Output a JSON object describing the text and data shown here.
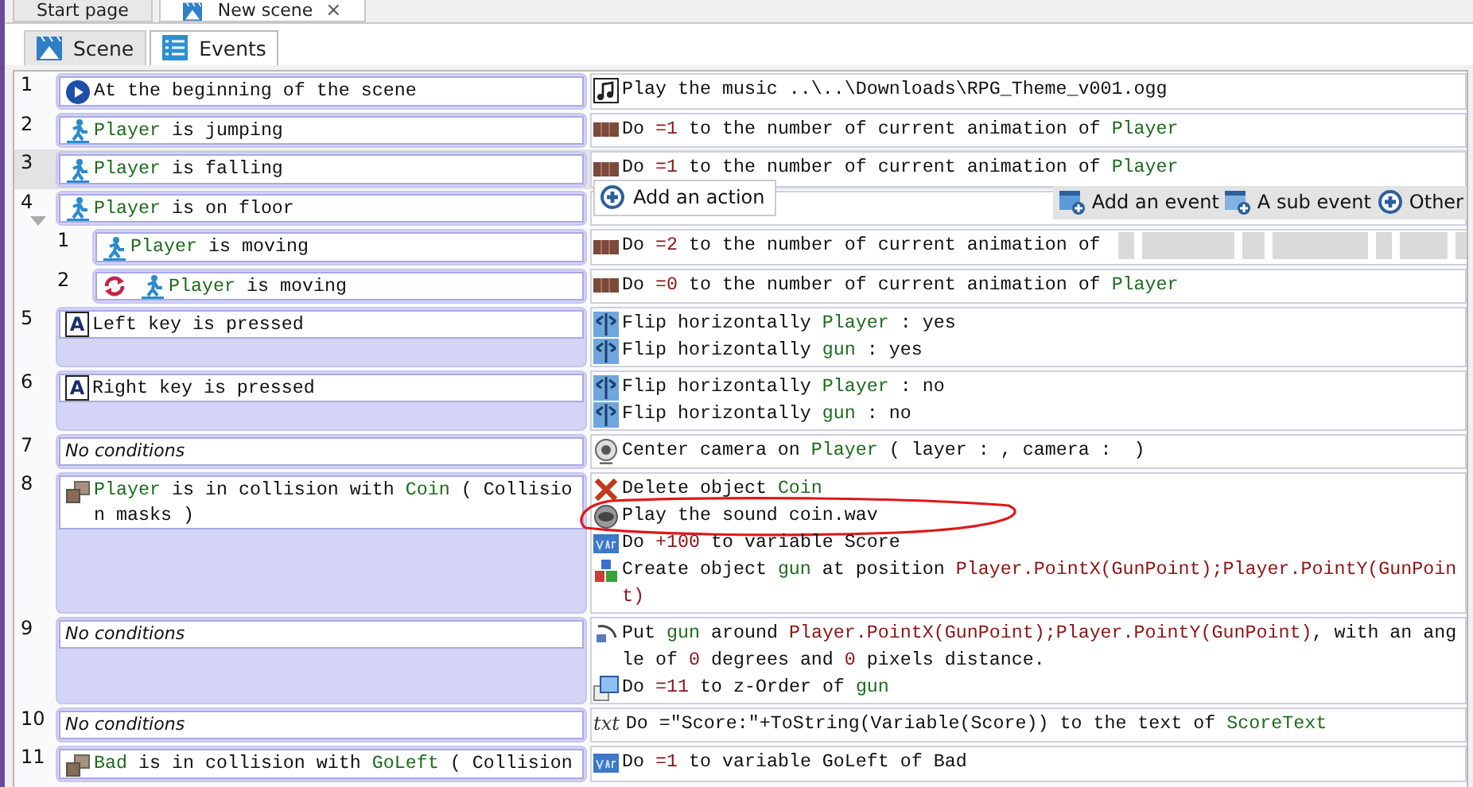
{
  "document_tabs": [
    {
      "label": "Start page",
      "selected": false
    },
    {
      "label": "New scene",
      "selected": true,
      "close": "×"
    }
  ],
  "editor_tabs": [
    {
      "label": "Scene",
      "kind": "scene",
      "selected": false
    },
    {
      "label": "Events",
      "kind": "events",
      "selected": true
    }
  ],
  "events": [
    {
      "number": "1",
      "selected": false,
      "expanded": false,
      "conditions": [
        {
          "kind": "start",
          "parts": [
            "At the beginning of the scene"
          ]
        }
      ],
      "actions": [
        {
          "kind": "music",
          "parts": [
            "Play the music ..\\..\\Downloads\\RPG_Theme_v001.ogg"
          ]
        }
      ]
    },
    {
      "number": "2",
      "selected": false,
      "expanded": false,
      "conditions": [
        {
          "kind": "object",
          "parts": [
            {
              "text": "Player",
              "kind": "object"
            },
            " is jumping"
          ]
        }
      ],
      "actions": [
        {
          "kind": "animation",
          "parts": [
            "Do ",
            {
              "text": "=1",
              "kind": "expr"
            },
            " to the number of current animation of ",
            {
              "text": "Player",
              "kind": "object"
            }
          ]
        }
      ]
    },
    {
      "number": "3",
      "selected": true,
      "expanded": false,
      "conditions": [
        {
          "kind": "object",
          "parts": [
            {
              "text": "Player",
              "kind": "object"
            },
            " is falling"
          ]
        }
      ],
      "actions": [
        {
          "kind": "animation",
          "parts": [
            "Do ",
            {
              "text": "=1",
              "kind": "expr"
            },
            " to the number of current animation of ",
            {
              "text": "Player",
              "kind": "object"
            }
          ]
        }
      ]
    },
    {
      "number": "4",
      "selected": false,
      "expanded": true,
      "conditions": [
        {
          "kind": "object",
          "parts": [
            {
              "text": "Player",
              "kind": "object"
            },
            " is on floor"
          ]
        }
      ],
      "popup": {
        "label": "Add an action"
      },
      "toolbar": [
        {
          "label": "Add an event",
          "kind": "event"
        },
        {
          "label": "A sub event",
          "kind": "sub-event"
        },
        {
          "label": "Other",
          "kind": "other"
        }
      ],
      "children": [
        {
          "number": "1",
          "selected": false,
          "expanded": false,
          "conditions": [
            {
              "kind": "object",
              "parts": [
                {
                  "text": "Player",
                  "kind": "object"
                },
                " is moving"
              ]
            }
          ],
          "actions": [
            {
              "kind": "animation",
              "obscured": true,
              "parts": [
                "Do ",
                {
                  "text": "=2",
                  "kind": "expr"
                },
                " to the number of current animation of "
              ]
            }
          ]
        },
        {
          "number": "2",
          "selected": false,
          "expanded": false,
          "conditions": [
            {
              "kind": "trigger-object",
              "parts": [
                {
                  "text": "Player",
                  "kind": "object"
                },
                " is moving"
              ]
            }
          ],
          "actions": [
            {
              "kind": "animation",
              "parts": [
                "Do ",
                {
                  "text": "=0",
                  "kind": "expr"
                },
                " to the number of current animation of ",
                {
                  "text": "Player",
                  "kind": "object"
                }
              ]
            }
          ]
        }
      ]
    },
    {
      "number": "5",
      "selected": false,
      "expanded": false,
      "conditions": [
        {
          "kind": "key",
          "glyph": "A",
          "parts": [
            "Left key is pressed"
          ]
        }
      ],
      "actions": [
        {
          "kind": "flip",
          "parts": [
            "Flip horizontally ",
            {
              "text": "Player",
              "kind": "object"
            },
            " : yes"
          ]
        },
        {
          "kind": "flip",
          "parts": [
            "Flip horizontally ",
            {
              "text": "gun",
              "kind": "object"
            },
            " : yes"
          ]
        }
      ]
    },
    {
      "number": "6",
      "selected": false,
      "expanded": false,
      "conditions": [
        {
          "kind": "key",
          "glyph": "A",
          "parts": [
            "Right key is pressed"
          ]
        }
      ],
      "actions": [
        {
          "kind": "flip",
          "parts": [
            "Flip horizontally ",
            {
              "text": "Player",
              "kind": "object"
            },
            " : no"
          ]
        },
        {
          "kind": "flip",
          "parts": [
            "Flip horizontally ",
            {
              "text": "gun",
              "kind": "object"
            },
            " : no"
          ]
        }
      ]
    },
    {
      "number": "7",
      "selected": false,
      "expanded": false,
      "conditions": [
        {
          "kind": "none",
          "parts": [
            "No conditions"
          ]
        }
      ],
      "actions": [
        {
          "kind": "camera",
          "parts": [
            "Center camera on ",
            {
              "text": "Player",
              "kind": "object"
            },
            " ( layer : , camera :  )"
          ]
        }
      ]
    },
    {
      "number": "8",
      "selected": false,
      "expanded": false,
      "conditions": [
        {
          "kind": "collision",
          "parts": [
            {
              "text": "Player",
              "kind": "object"
            },
            " is in collision with ",
            {
              "text": "Coin",
              "kind": "object"
            },
            " ( Collision masks )"
          ]
        }
      ],
      "actions": [
        {
          "kind": "delete",
          "parts": [
            "Delete object ",
            {
              "text": "Coin",
              "kind": "object"
            }
          ]
        },
        {
          "kind": "sound",
          "circled": true,
          "parts": [
            "Play the sound coin.wav"
          ]
        },
        {
          "kind": "variable",
          "parts": [
            "Do ",
            {
              "text": "+100",
              "kind": "expr"
            },
            " to variable Score"
          ]
        },
        {
          "kind": "create",
          "parts": [
            "Create object ",
            {
              "text": "gun",
              "kind": "object"
            },
            " at position ",
            {
              "text": "Player.PointX(GunPoint);Player.PointY(GunPoint)",
              "kind": "expr"
            }
          ]
        }
      ]
    },
    {
      "number": "9",
      "selected": false,
      "expanded": false,
      "conditions": [
        {
          "kind": "none",
          "parts": [
            "No conditions"
          ]
        }
      ],
      "actions": [
        {
          "kind": "put-around",
          "parts": [
            "Put ",
            {
              "text": "gun",
              "kind": "object"
            },
            " around ",
            {
              "text": "Player.PointX(GunPoint);Player.PointY(GunPoint)",
              "kind": "expr"
            },
            ", with an angle of ",
            {
              "text": "0",
              "kind": "expr"
            },
            " degrees and ",
            {
              "text": "0",
              "kind": "expr"
            },
            " pixels distance."
          ]
        },
        {
          "kind": "zorder",
          "parts": [
            "Do ",
            {
              "text": "=11",
              "kind": "expr"
            },
            " to z-Order of ",
            {
              "text": "gun",
              "kind": "object"
            }
          ]
        }
      ]
    },
    {
      "number": "10",
      "selected": false,
      "expanded": false,
      "conditions": [
        {
          "kind": "none",
          "parts": [
            "No conditions"
          ]
        }
      ],
      "actions": [
        {
          "kind": "text",
          "glyph": "txt",
          "parts": [
            "Do =\"Score:\"+ToString(Variable(Score)) to the text of ",
            {
              "text": "ScoreText",
              "kind": "object"
            }
          ]
        }
      ]
    },
    {
      "number": "11",
      "selected": false,
      "expanded": false,
      "conditions": [
        {
          "kind": "collision",
          "parts": [
            {
              "text": "Bad",
              "kind": "object"
            },
            " is in collision with ",
            {
              "text": "GoLeft",
              "kind": "object"
            },
            " ( Collision"
          ]
        }
      ],
      "actions": [
        {
          "kind": "variable",
          "parts": [
            "Do ",
            {
              "text": "=1",
              "kind": "expr"
            },
            " to variable GoLeft of Bad"
          ]
        }
      ]
    }
  ]
}
